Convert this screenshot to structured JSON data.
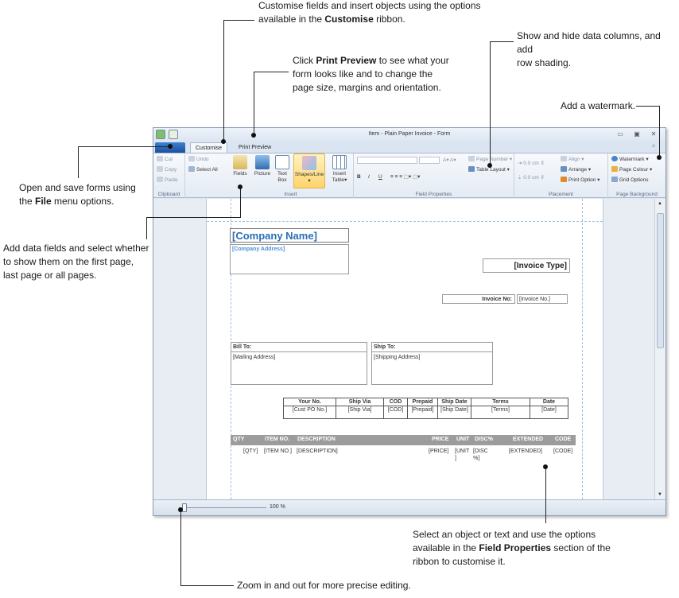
{
  "callouts": {
    "customise": {
      "pre": "Customise fields and insert objects using the options",
      "line2_pre": "available in the ",
      "bold": "Customise",
      "post": " ribbon."
    },
    "print_preview": {
      "pre": "Click ",
      "bold": "Print Preview",
      "post": " to see what your",
      "line2": "form looks like and to change the",
      "line3": "page size, margins and orientation."
    },
    "columns": {
      "line1": "Show and hide data columns, and add",
      "line2": "row shading."
    },
    "watermark": {
      "text": "Add a watermark."
    },
    "file": {
      "line1": "Open and save forms using",
      "pre": "the ",
      "bold": "File",
      "post": " menu options."
    },
    "fields": {
      "line1": "Add data fields and select whether",
      "line2": "to show them on the first page,",
      "line3": "last page or all pages."
    },
    "field_props": {
      "line1": "Select an object or text and use the options",
      "pre": "available in the ",
      "bold": "Field Properties",
      "post": " section of the",
      "line3": "ribbon to customise it."
    },
    "zoom": {
      "text": "Zoom in and out for more precise editing."
    }
  },
  "window": {
    "title": "Item - Plain Paper Invoice - Form",
    "tabs": [
      "Customise",
      "Print Preview"
    ],
    "ribbon": {
      "clipboard": {
        "label": "Clipboard",
        "cut": "Cut",
        "copy": "Copy",
        "paste": "Paste"
      },
      "undo": {
        "undo": "Undo",
        "select_all": "Select All"
      },
      "insert": {
        "label": "Insert",
        "fields": "Fields",
        "picture": "Picture",
        "text_box_1": "Text",
        "text_box_2": "Box",
        "shapes_line": "Shapes/Line",
        "insert_table_1": "Insert",
        "insert_table_2": "Table"
      },
      "field_properties": {
        "label": "Field Properties",
        "page_number": "Page Number",
        "table_layout": "Table Layout",
        "bold": "B",
        "italic": "I",
        "underline": "U"
      },
      "placement": {
        "label": "Placement",
        "spin1": "0.0 cm",
        "spin2": "0.0 cm",
        "align": "Align",
        "arrange": "Arrange",
        "print_option": "Print Option"
      },
      "page_background": {
        "label": "Page Background",
        "watermark": "Watermark",
        "page_colour": "Page Colour",
        "grid_options": "Grid Options"
      }
    },
    "zoom": "100 %"
  },
  "invoice": {
    "company_name": "[Company Name]",
    "company_address": "[Company Address]",
    "invoice_type": "[Invoice Type]",
    "invoice_no_label": "Invoice No:",
    "invoice_no_value": "[Invoice No.]",
    "bill_to": "Bill To:",
    "mailing_address": "[Mailing Address]",
    "ship_to": "Ship To:",
    "shipping_address": "[Shipping Address]",
    "order_headers": [
      "Your No.",
      "Ship Via",
      "COD",
      "Prepaid",
      "Ship Date",
      "Terms",
      "Date"
    ],
    "order_values": [
      "[Cust PO No.]",
      "[Ship Via]",
      "[COD]",
      "[Prepaid]",
      "[Ship Date]",
      "[Terms]",
      "[Date]"
    ],
    "item_headers": [
      "QTY",
      "ITEM NO.",
      "DESCRIPTION",
      "PRICE",
      "UNIT",
      "DISC%",
      "EXTENDED",
      "CODE"
    ],
    "item_values": [
      "[QTY]",
      "[ITEM NO.]",
      "[DESCRIPTION]",
      "[PRICE]",
      "[UNIT ]",
      "[DISC %]",
      "[EXTENDED]",
      "[CODE]"
    ]
  },
  "colors": {
    "accent": "#1f5ea8",
    "company_name": "#2a6fb5",
    "header_fill": "#9c9c9c"
  }
}
